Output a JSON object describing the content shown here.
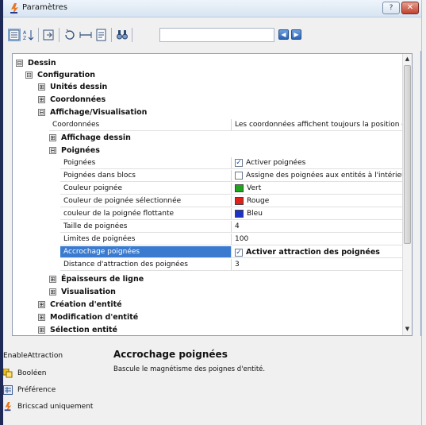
{
  "window": {
    "title": "Paramètres",
    "help_label": "?",
    "close_label": "✕"
  },
  "toolbar": {
    "search_value": "",
    "back_label": "◀",
    "forward_label": "▶"
  },
  "tree": {
    "n_dessin": "Dessin",
    "n_configuration": "Configuration",
    "n_unites": "Unités dessin",
    "n_coordonnees": "Coordonnées",
    "n_affichage_vis": "Affichage/Visualisation",
    "p_coordonnees": {
      "label": "Coordonnées",
      "value": "Les coordonnées affichent toujours la position du"
    },
    "n_affichage_dessin": "Affichage dessin",
    "n_poignees": "Poignées",
    "props": [
      {
        "label": "Poignées",
        "value": "Activer poignées",
        "kind": "check",
        "checked": "✓"
      },
      {
        "label": "Poignées dans blocs",
        "value": "Assigne des poignées aux entités à l'intérieur d",
        "kind": "check",
        "checked": ""
      },
      {
        "label": "Couleur poignée",
        "value": "Vert",
        "kind": "color",
        "color": "#1ea51e"
      },
      {
        "label": "Couleur de poignée sélectionnée",
        "value": "Rouge",
        "kind": "color",
        "color": "#e0201a"
      },
      {
        "label": "couleur de la poignée flottante",
        "value": "Bleu",
        "kind": "color",
        "color": "#1b32c8"
      },
      {
        "label": "Taille de poignées",
        "value": "4",
        "kind": "text"
      },
      {
        "label": "Limites de poignées",
        "value": "100",
        "kind": "text"
      },
      {
        "label": "Accrochage poignées",
        "value": "Activer attraction des poignées",
        "kind": "check",
        "checked": "✓",
        "selected": true
      },
      {
        "label": "Distance d'attraction des poignées",
        "value": "3",
        "kind": "text"
      }
    ],
    "n_epaisseurs": "Épaisseurs de ligne",
    "n_visualisation": "Visualisation",
    "n_creation": "Création d'entité",
    "n_modification": "Modification d'entité",
    "n_selection": "Sélection entité",
    "expanded_glyph": "⊟",
    "collapsed_glyph": "⊞"
  },
  "footer": {
    "var_name": "EnableAttraction",
    "title": "Accrochage poignées",
    "description": "Bascule le magnétisme des poignes d'entité.",
    "type_label": "Booléen",
    "scope_label": "Préférence",
    "product_label": "Bricscad uniquement"
  },
  "colors": {
    "selection": "#3a7bd0",
    "accent": "#2b63b4"
  }
}
